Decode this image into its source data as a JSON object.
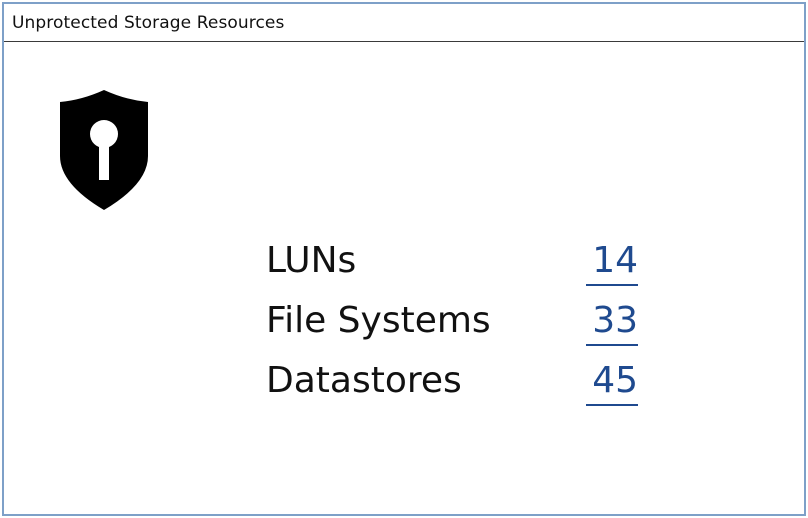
{
  "window": {
    "title": "Unprotected Storage Resources"
  },
  "icon": {
    "name": "shield-keyhole-icon",
    "color": "#000000"
  },
  "stats": [
    {
      "label": "LUNs",
      "value": "14"
    },
    {
      "label": "File Systems",
      "value": "33"
    },
    {
      "label": "Datastores",
      "value": "45"
    }
  ],
  "colors": {
    "link": "#1f4a8f",
    "text": "#111111",
    "frame": "#7ea0c8"
  }
}
